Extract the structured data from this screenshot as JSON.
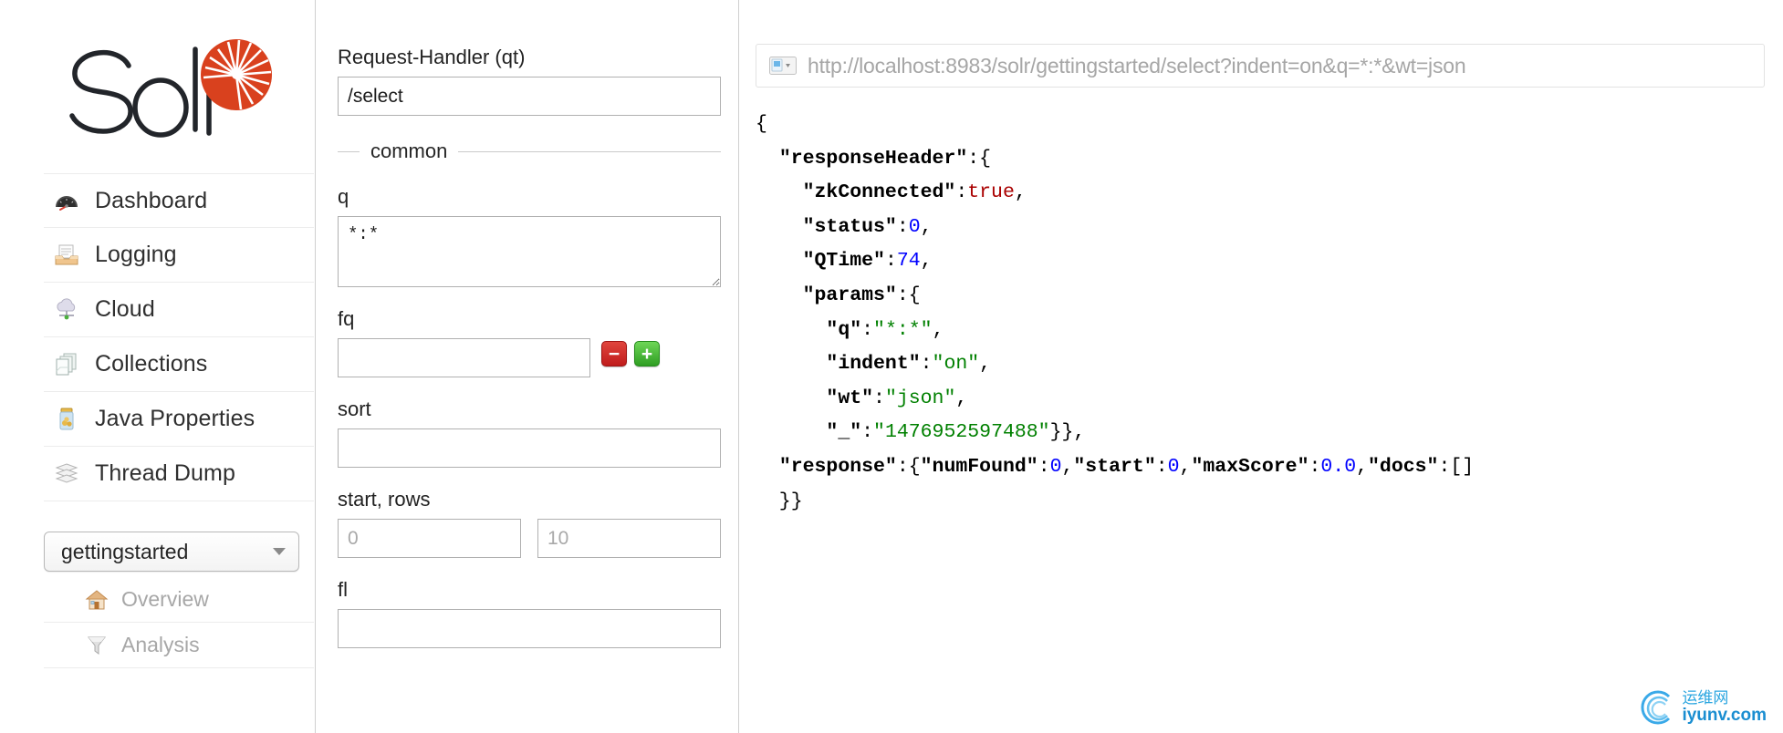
{
  "brand": {
    "name": "Solr",
    "logo_red": "#d9411e",
    "logo_dark": "#22252a"
  },
  "sidebar": {
    "items": [
      {
        "label": "Dashboard",
        "icon": "dashboard-gauge-icon"
      },
      {
        "label": "Logging",
        "icon": "logging-tray-icon"
      },
      {
        "label": "Cloud",
        "icon": "cloud-icon"
      },
      {
        "label": "Collections",
        "icon": "collections-pages-icon"
      },
      {
        "label": "Java Properties",
        "icon": "java-jar-icon"
      },
      {
        "label": "Thread Dump",
        "icon": "thread-dump-stack-icon"
      }
    ],
    "collection_selector": {
      "value": "gettingstarted",
      "caret": "chevron-down-icon"
    },
    "sub_items": [
      {
        "label": "Overview",
        "icon": "home-icon"
      },
      {
        "label": "Analysis",
        "icon": "funnel-icon"
      }
    ]
  },
  "query_form": {
    "request_handler": {
      "label": "Request-Handler (qt)",
      "value": "/select"
    },
    "fieldset_legend": "common",
    "q": {
      "label": "q",
      "value": "*:*"
    },
    "fq": {
      "label": "fq",
      "value": "",
      "remove_button": "−",
      "add_button": "+"
    },
    "sort": {
      "label": "sort",
      "value": ""
    },
    "start_rows": {
      "label": "start, rows",
      "start_placeholder": "0",
      "rows_placeholder": "10"
    },
    "fl": {
      "label": "fl",
      "value": ""
    }
  },
  "response": {
    "url_icon": "url-dropdown-icon",
    "url": "http://localhost:8983/solr/gettingstarted/select?indent=on&q=*:*&wt=json",
    "json_lines": [
      [
        {
          "t": "{",
          "c": "punc"
        }
      ],
      [
        {
          "t": "  ",
          "c": "punc"
        },
        {
          "t": "\"responseHeader\"",
          "c": "key"
        },
        {
          "t": ":{",
          "c": "punc"
        }
      ],
      [
        {
          "t": "    ",
          "c": "punc"
        },
        {
          "t": "\"zkConnected\"",
          "c": "key"
        },
        {
          "t": ":",
          "c": "punc"
        },
        {
          "t": "true",
          "c": "bool"
        },
        {
          "t": ",",
          "c": "punc"
        }
      ],
      [
        {
          "t": "    ",
          "c": "punc"
        },
        {
          "t": "\"status\"",
          "c": "key"
        },
        {
          "t": ":",
          "c": "punc"
        },
        {
          "t": "0",
          "c": "num"
        },
        {
          "t": ",",
          "c": "punc"
        }
      ],
      [
        {
          "t": "    ",
          "c": "punc"
        },
        {
          "t": "\"QTime\"",
          "c": "key"
        },
        {
          "t": ":",
          "c": "punc"
        },
        {
          "t": "74",
          "c": "num"
        },
        {
          "t": ",",
          "c": "punc"
        }
      ],
      [
        {
          "t": "    ",
          "c": "punc"
        },
        {
          "t": "\"params\"",
          "c": "key"
        },
        {
          "t": ":{",
          "c": "punc"
        }
      ],
      [
        {
          "t": "      ",
          "c": "punc"
        },
        {
          "t": "\"q\"",
          "c": "key"
        },
        {
          "t": ":",
          "c": "punc"
        },
        {
          "t": "\"*:*\"",
          "c": "str"
        },
        {
          "t": ",",
          "c": "punc"
        }
      ],
      [
        {
          "t": "      ",
          "c": "punc"
        },
        {
          "t": "\"indent\"",
          "c": "key"
        },
        {
          "t": ":",
          "c": "punc"
        },
        {
          "t": "\"on\"",
          "c": "str"
        },
        {
          "t": ",",
          "c": "punc"
        }
      ],
      [
        {
          "t": "      ",
          "c": "punc"
        },
        {
          "t": "\"wt\"",
          "c": "key"
        },
        {
          "t": ":",
          "c": "punc"
        },
        {
          "t": "\"json\"",
          "c": "str"
        },
        {
          "t": ",",
          "c": "punc"
        }
      ],
      [
        {
          "t": "      ",
          "c": "punc"
        },
        {
          "t": "\"_\"",
          "c": "key"
        },
        {
          "t": ":",
          "c": "punc"
        },
        {
          "t": "\"1476952597488\"",
          "c": "str"
        },
        {
          "t": "}},",
          "c": "punc"
        }
      ],
      [
        {
          "t": "  ",
          "c": "punc"
        },
        {
          "t": "\"response\"",
          "c": "key"
        },
        {
          "t": ":{",
          "c": "punc"
        },
        {
          "t": "\"numFound\"",
          "c": "key"
        },
        {
          "t": ":",
          "c": "punc"
        },
        {
          "t": "0",
          "c": "num"
        },
        {
          "t": ",",
          "c": "punc"
        },
        {
          "t": "\"start\"",
          "c": "key"
        },
        {
          "t": ":",
          "c": "punc"
        },
        {
          "t": "0",
          "c": "num"
        },
        {
          "t": ",",
          "c": "punc"
        },
        {
          "t": "\"maxScore\"",
          "c": "key"
        },
        {
          "t": ":",
          "c": "punc"
        },
        {
          "t": "0.0",
          "c": "num"
        },
        {
          "t": ",",
          "c": "punc"
        },
        {
          "t": "\"docs\"",
          "c": "key"
        },
        {
          "t": ":[]",
          "c": "punc"
        }
      ],
      [
        {
          "t": "  }}",
          "c": "punc"
        }
      ]
    ]
  },
  "watermark": {
    "cn": "运维网",
    "en": "iyunv.com",
    "color": "#1a8ed1"
  }
}
